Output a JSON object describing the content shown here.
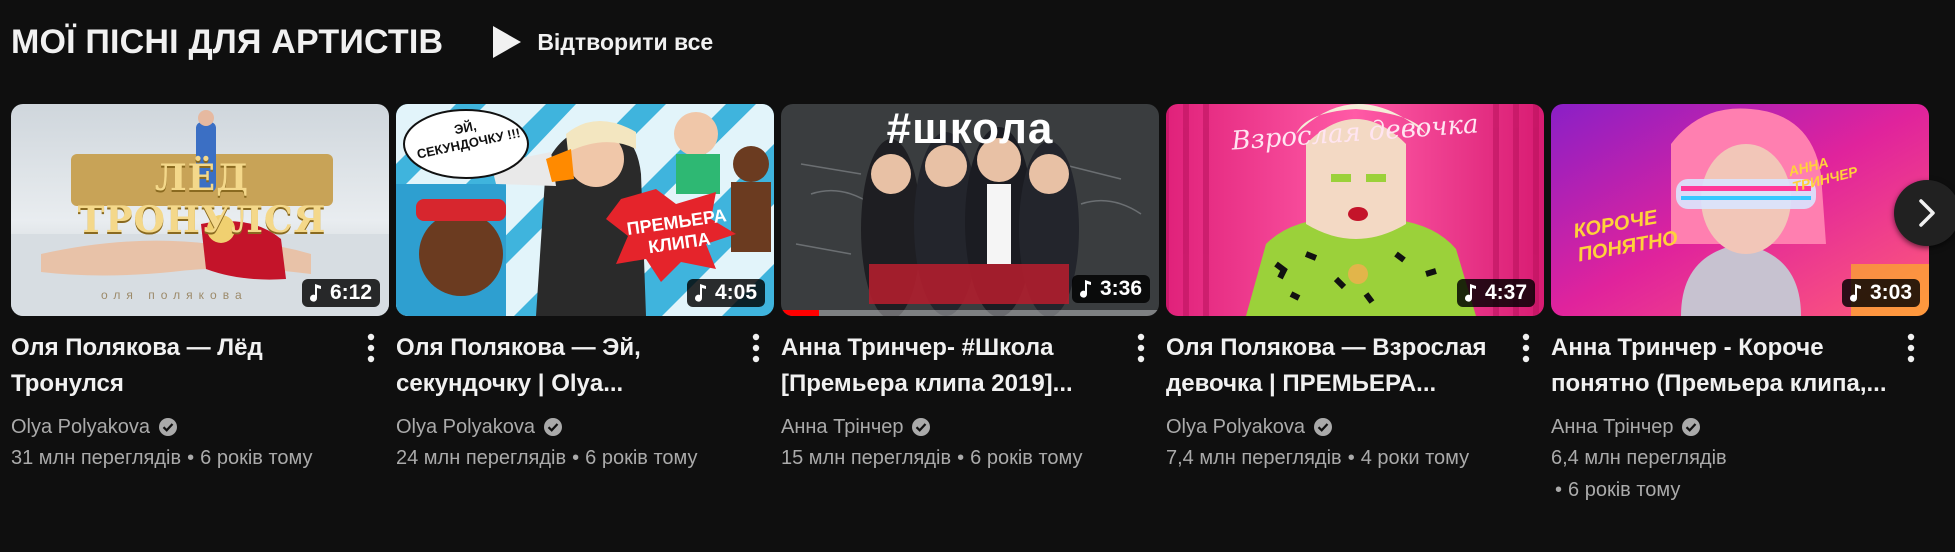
{
  "shelf": {
    "title": "МОЇ ПІСНІ ДЛЯ АРТИСТІВ",
    "play_all_label": "Відтворити все",
    "play_all_icon": "play-icon",
    "next_icon": "chevron-right-icon"
  },
  "colors": {
    "background": "#0f0f0f",
    "primary_text": "#f1f1f1",
    "secondary_text": "#aaaaaa",
    "progress": "#ff0000"
  },
  "videos": [
    {
      "title": "Оля Полякова — Лёд Тронулся",
      "duration": "6:12",
      "channel": "Olya Polyakova",
      "views": "31 млн переглядів",
      "age": "6 років тому",
      "thumb_text": "ЛЁД ТРОНУЛСЯ",
      "thumb_caption": "оля полякова",
      "watched_fraction": 0
    },
    {
      "title": "Оля Полякова — Эй, секундочку | Olya...",
      "duration": "4:05",
      "channel": "Olya Polyakova",
      "views": "24 млн переглядів",
      "age": "6 років тому",
      "thumb_text": "ПРЕМЬЕРА КЛИПА",
      "thumb_bubble": "ЭЙ, СЕКУНДОЧКУ !!!",
      "watched_fraction": 0
    },
    {
      "title": "Анна Тринчер- #Школа [Премьера клипа 2019]...",
      "duration": "3:36",
      "channel": "Анна Трінчер",
      "views": "15 млн переглядів",
      "age": "6 років тому",
      "thumb_text": "#школа",
      "watched_fraction": 0.1
    },
    {
      "title": "Оля Полякова — Взрослая девочка | ПРЕМЬЕРА...",
      "duration": "4:37",
      "channel": "Olya Polyakova",
      "views": "7,4 млн переглядів",
      "age": "4 роки тому",
      "thumb_text": "Взрослая девочка",
      "watched_fraction": 0
    },
    {
      "title": "Анна Тринчер - Короче понятно (Премьера клипа,...",
      "duration": "3:03",
      "channel": "Анна Трінчер",
      "views": "6,4 млн переглядів",
      "age": "6 років тому",
      "thumb_text": "КОРОЧЕ ПОНЯТНО",
      "thumb_caption": "АННА ТРИНЧЕР",
      "watched_fraction": 0
    }
  ]
}
